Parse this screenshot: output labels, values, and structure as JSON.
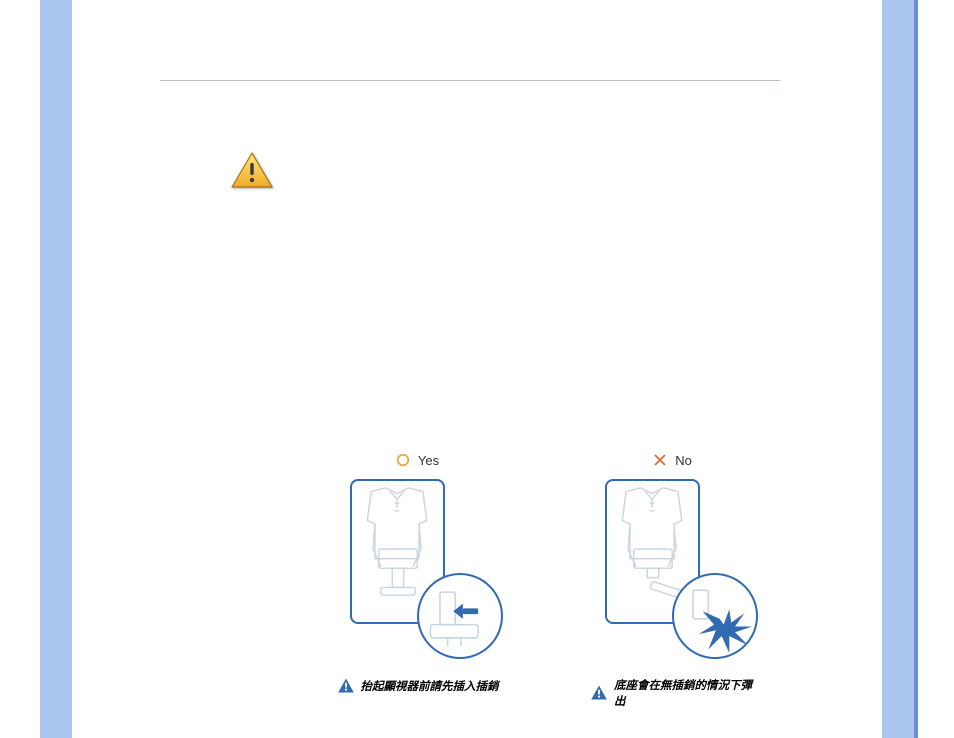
{
  "colors": {
    "band": "#aac6ef",
    "stroke": "#2f6ab3",
    "cross": "#e36a2b",
    "circle": "#e8a23a"
  },
  "labels": {
    "yes": "Yes",
    "no": "No"
  },
  "captions": {
    "yes": "抬起顯視器前請先插入插銷",
    "no": "底座會在無插銷的情況下彈出"
  },
  "warning_text": ""
}
